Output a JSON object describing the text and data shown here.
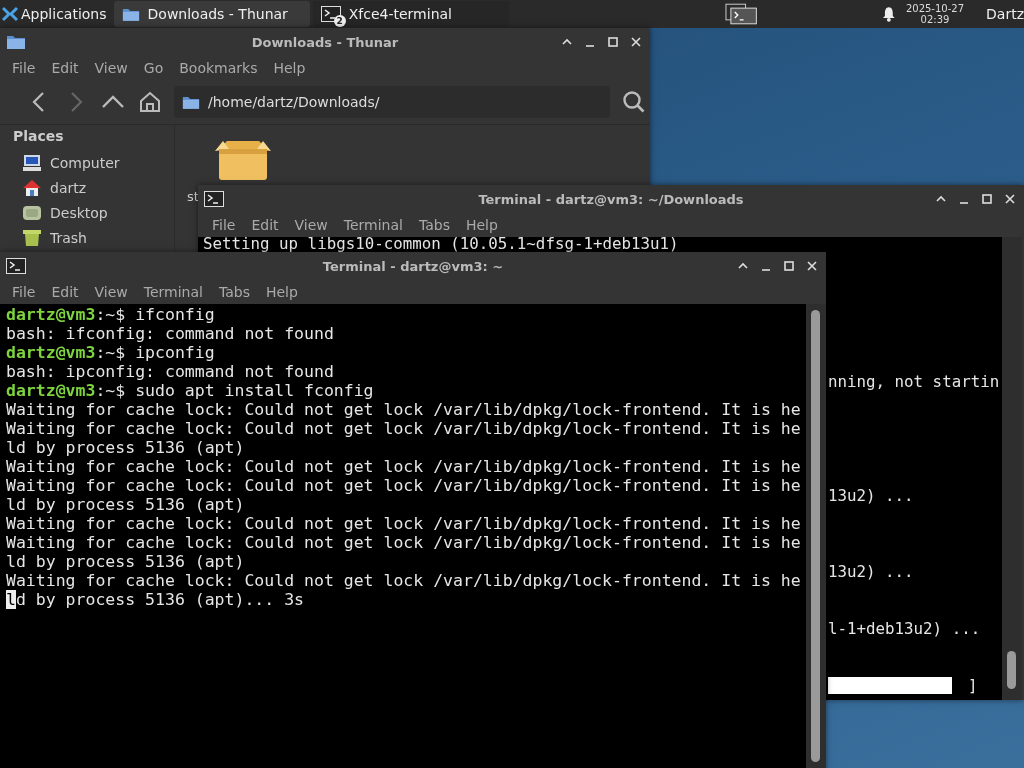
{
  "panel": {
    "apps_label": "Applications",
    "tasks": [
      {
        "label": "Downloads - Thunar",
        "kind": "folder",
        "selected": true
      },
      {
        "label": "Xfce4-terminal",
        "kind": "terminal",
        "badge": "2",
        "selected": false
      }
    ],
    "date": "2025-10-27",
    "time": "02:39",
    "user": "Dartz"
  },
  "file_manager": {
    "title": "Downloads - Thunar",
    "menu": [
      "File",
      "Edit",
      "View",
      "Go",
      "Bookmarks",
      "Help"
    ],
    "tools": [
      {
        "kind": "back",
        "disabled": false
      },
      {
        "kind": "forward",
        "disabled": true
      },
      {
        "kind": "up",
        "disabled": false
      },
      {
        "kind": "home",
        "disabled": false
      }
    ],
    "location": "/home/dartz/Downloads/",
    "places_heading": "Places",
    "places": [
      {
        "label": "Computer",
        "kind": "computer"
      },
      {
        "label": "dartz",
        "kind": "home"
      },
      {
        "label": "Desktop",
        "kind": "desktop"
      },
      {
        "label": "Trash",
        "kind": "trash"
      }
    ],
    "files": [
      {
        "label": "st",
        "kind": "package"
      }
    ]
  },
  "terminal_back": {
    "title": "Terminal - dartz@vm3: ~/Downloads",
    "menu": [
      "File",
      "Edit",
      "View",
      "Terminal",
      "Tabs",
      "Help"
    ],
    "lines": [
      "Setting up libgs10-common (10.05.1~dfsg-1+deb13u1)"
    ],
    "fragments": [
      "nning, not startin",
      "13u2) ...",
      "13u2) ...",
      "l-1+deb13u2) ..."
    ],
    "progress_end": "]"
  },
  "terminal_front": {
    "title": "Terminal - dartz@vm3: ~",
    "menu": [
      "File",
      "Edit",
      "View",
      "Terminal",
      "Tabs",
      "Help"
    ],
    "lines": [
      {
        "kind": "prompt",
        "prompt": "dartz@vm3",
        "text": ":~$ ifconfig"
      },
      {
        "kind": "output",
        "text": "bash: ifconfig: command not found"
      },
      {
        "kind": "prompt",
        "prompt": "dartz@vm3",
        "text": ":~$ ipconfig"
      },
      {
        "kind": "output",
        "text": "bash: ipconfig: command not found"
      },
      {
        "kind": "prompt",
        "prompt": "dartz@vm3",
        "text": ":~$ sudo apt install fconfig"
      },
      {
        "kind": "output",
        "text": "Waiting for cache lock: Could not get lock /var/lib/dpkg/lock-frontend. It is he"
      },
      {
        "kind": "output",
        "text": "Waiting for cache lock: Could not get lock /var/lib/dpkg/lock-frontend. It is he"
      },
      {
        "kind": "output",
        "text": "ld by process 5136 (apt)"
      },
      {
        "kind": "output",
        "text": "Waiting for cache lock: Could not get lock /var/lib/dpkg/lock-frontend. It is he"
      },
      {
        "kind": "output",
        "text": "Waiting for cache lock: Could not get lock /var/lib/dpkg/lock-frontend. It is he"
      },
      {
        "kind": "output",
        "text": "ld by process 5136 (apt)"
      },
      {
        "kind": "output",
        "text": "Waiting for cache lock: Could not get lock /var/lib/dpkg/lock-frontend. It is he"
      },
      {
        "kind": "output",
        "text": "Waiting for cache lock: Could not get lock /var/lib/dpkg/lock-frontend. It is he"
      },
      {
        "kind": "output",
        "text": "ld by process 5136 (apt)"
      },
      {
        "kind": "output",
        "text": "Waiting for cache lock: Could not get lock /var/lib/dpkg/lock-frontend. It is he"
      },
      {
        "kind": "output",
        "text": "ld by process 5136 (apt)... 3s",
        "cursor": true
      }
    ]
  }
}
